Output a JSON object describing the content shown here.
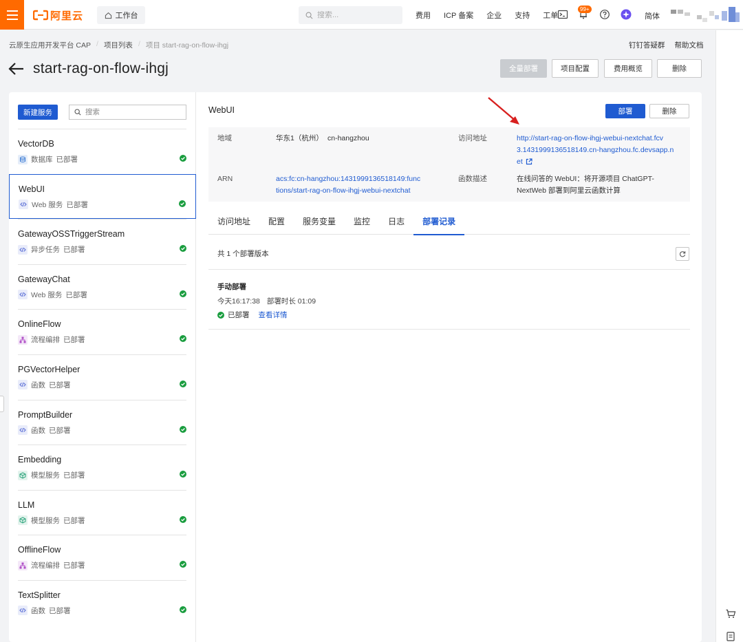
{
  "topbar": {
    "logo_text": "阿里云",
    "workbench": "工作台",
    "search_placeholder": "搜索...",
    "nav": [
      "费用",
      "ICP 备案",
      "企业",
      "支持",
      "工单"
    ],
    "badge": "99+",
    "lang": "简体"
  },
  "breadcrumb": {
    "items": [
      "云原生应用开发平台 CAP",
      "项目列表",
      "项目 start-rag-on-flow-ihgj"
    ]
  },
  "top_links": {
    "dingtalk": "钉钉答疑群",
    "help": "帮助文档"
  },
  "page": {
    "title": "start-rag-on-flow-ihgj",
    "btn_full_deploy": "全量部署",
    "btn_project_config": "项目配置",
    "btn_cost_overview": "费用概览",
    "btn_delete": "删除"
  },
  "sidebar": {
    "new_service": "新建服务",
    "search_placeholder": "搜索",
    "status_ok_color": "#1a9d3f",
    "services": [
      {
        "name": "VectorDB",
        "type": "数据库",
        "status": "已部署",
        "icon": "database-icon",
        "color": "#3a7bd5"
      },
      {
        "name": "WebUI",
        "type": "Web 服务",
        "status": "已部署",
        "icon": "code-icon",
        "color": "#5b6fd6"
      },
      {
        "name": "GatewayOSSTriggerStream",
        "type": "异步任务",
        "status": "已部署",
        "icon": "code-icon",
        "color": "#5b6fd6"
      },
      {
        "name": "GatewayChat",
        "type": "Web 服务",
        "status": "已部署",
        "icon": "code-icon",
        "color": "#5b6fd6"
      },
      {
        "name": "OnlineFlow",
        "type": "流程编排",
        "status": "已部署",
        "icon": "flow-icon",
        "color": "#b04fc7"
      },
      {
        "name": "PGVectorHelper",
        "type": "函数",
        "status": "已部署",
        "icon": "code-icon",
        "color": "#5b6fd6"
      },
      {
        "name": "PromptBuilder",
        "type": "函数",
        "status": "已部署",
        "icon": "code-icon",
        "color": "#5b6fd6"
      },
      {
        "name": "Embedding",
        "type": "模型服务",
        "status": "已部署",
        "icon": "cube-icon",
        "color": "#2aa37a"
      },
      {
        "name": "LLM",
        "type": "模型服务",
        "status": "已部署",
        "icon": "cube-icon",
        "color": "#2aa37a"
      },
      {
        "name": "OfflineFlow",
        "type": "流程编排",
        "status": "已部署",
        "icon": "flow-icon",
        "color": "#b04fc7"
      },
      {
        "name": "TextSplitter",
        "type": "函数",
        "status": "已部署",
        "icon": "code-icon",
        "color": "#5b6fd6"
      }
    ],
    "active_index": 1
  },
  "detail": {
    "title": "WebUI",
    "btn_deploy": "部署",
    "btn_delete": "删除",
    "region_label": "地域",
    "region_value": "华东1（杭州）",
    "region_code": "cn-hangzhou",
    "url_label": "访问地址",
    "url_lines": [
      "http://start-rag-on-flow-ihgj-webui-nextchat.fcv",
      "3.1431999136518149.cn-hangzhou.fc.devsapp.n",
      "et"
    ],
    "arn_label": "ARN",
    "arn_lines": [
      "acs:fc:cn-hangzhou:1431999136518149:func",
      "tions/start-rag-on-flow-ihgj-webui-nextchat"
    ],
    "desc_label": "函数描述",
    "desc_lines": [
      "在线问答的 WebUI：将开源项目 ChatGPT-",
      "NextWeb 部署到阿里云函数计算"
    ]
  },
  "tabs": [
    "访问地址",
    "配置",
    "服务变量",
    "监控",
    "日志",
    "部署记录"
  ],
  "active_tab": 5,
  "records": {
    "count_text": "共 1 个部署版本",
    "items": [
      {
        "title": "手动部署",
        "time": "今天16:17:38",
        "duration": "部署时长 01:09",
        "status": "已部署",
        "detail_link": "查看详情"
      }
    ]
  },
  "colors": {
    "brand": "#ff6a00",
    "primary": "#1f5bd1",
    "annotation_arrow": "#d8201f"
  }
}
